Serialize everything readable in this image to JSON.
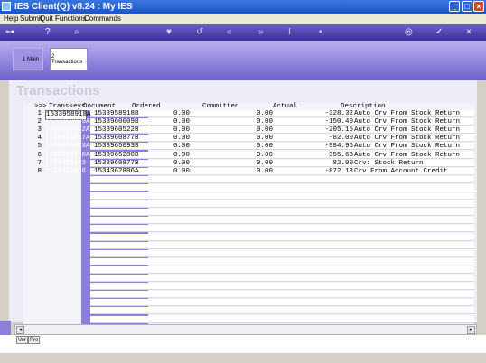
{
  "window": {
    "title": "IES Client(Q) v8.24 : My IES"
  },
  "menu": [
    "Help",
    "Submit",
    "Quit",
    "Functions",
    "Commands"
  ],
  "toolbar": {
    "icons": [
      "key-icon",
      "help-icon",
      "search-icon",
      "heart-icon",
      "history-icon",
      "rewind-icon",
      "fast-forward-icon",
      "text-cursor-icon",
      "clipboard-icon",
      "globe-icon",
      "check-icon",
      "close-icon"
    ]
  },
  "tabs": {
    "main": "1 Main",
    "transactions": "2 Transactions"
  },
  "page": {
    "heading": "Transactions"
  },
  "grid": {
    "headers": {
      "marker": ">>>",
      "transkeys": "Transkeys",
      "document": "Document",
      "ordered": "Ordered",
      "committed": "Committed",
      "actual": "Actual",
      "description": "Description"
    },
    "rows": [
      {
        "n": "1",
        "key": "1533958918A",
        "doc": "1533958918B",
        "ordered": "0.00",
        "committed": "0.00",
        "actual": "-328.32",
        "desc": "Auto Crv From Stock Return"
      },
      {
        "n": "2",
        "key": "1533960009A",
        "doc": "1533960009B",
        "ordered": "0.00",
        "committed": "0.00",
        "actual": "-150.40",
        "desc": "Auto Crv From Stock Return"
      },
      {
        "n": "3",
        "key": "1533960522A",
        "doc": "1533960522B",
        "ordered": "0.00",
        "committed": "0.00",
        "actual": "-205.15",
        "desc": "Auto Crv From Stock Return"
      },
      {
        "n": "4",
        "key": "1533960877A",
        "doc": "1533960877B",
        "ordered": "0.00",
        "committed": "0.00",
        "actual": "-82.00",
        "desc": "Auto Crv From Stock Return"
      },
      {
        "n": "5",
        "key": "1533965093A",
        "doc": "1533965093B",
        "ordered": "0.00",
        "committed": "0.00",
        "actual": "-984.96",
        "desc": "Auto Crv From Stock Return"
      },
      {
        "n": "6",
        "key": "1533965280A",
        "doc": "1533965280B",
        "ordered": "0.00",
        "committed": "0.00",
        "actual": "-355.68",
        "desc": "Auto Crv From Stock Return"
      },
      {
        "n": "7",
        "key": "1534358133",
        "doc": "1533960877B",
        "ordered": "0.00",
        "committed": "0.00",
        "actual": "82.00",
        "desc": "Crv: Stock Return"
      },
      {
        "n": "8",
        "key": "1534362806",
        "doc": "1534362806A",
        "ordered": "0.00",
        "committed": "0.00",
        "actual": "-872.13",
        "desc": "Crv From Account Credit"
      }
    ]
  },
  "bottom_tabs": [
    "Ver",
    "Pre"
  ],
  "colors": {
    "accent": "#8a80dc",
    "toolbar": "#3e2f9b"
  }
}
